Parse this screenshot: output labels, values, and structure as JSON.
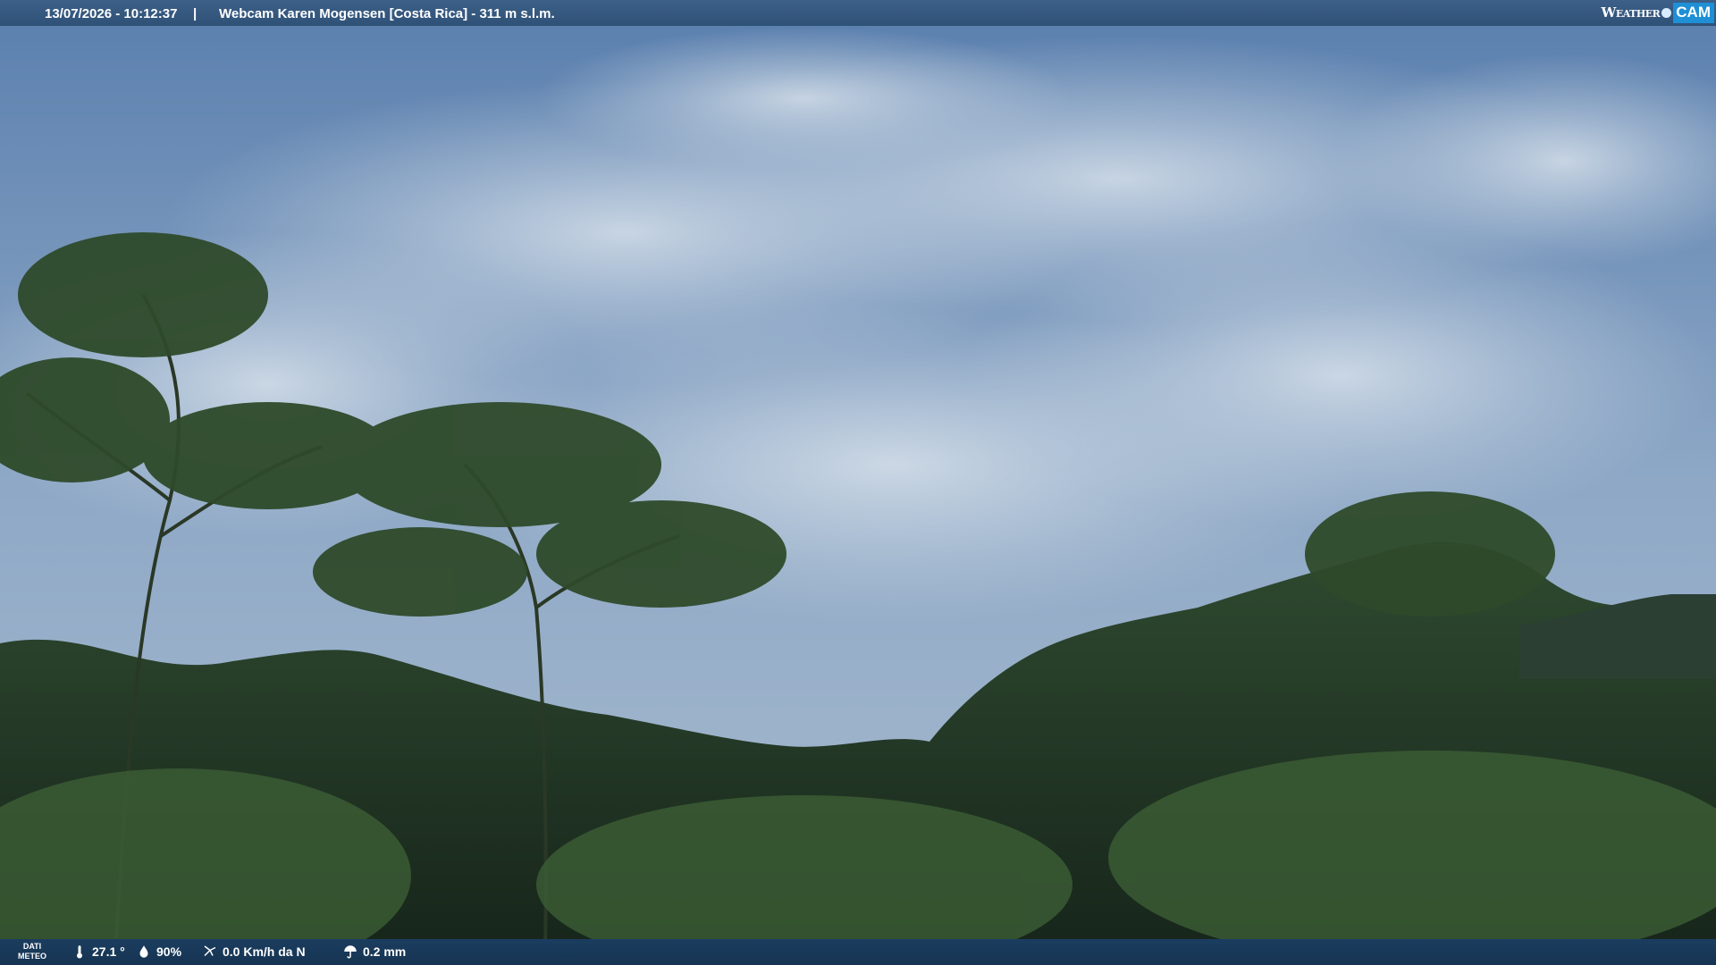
{
  "header": {
    "datetime": "13/07/2026 - 10:12:37",
    "separator": "|",
    "title": "Webcam Karen Mogensen [Costa Rica]  - 311 m s.l.m."
  },
  "logo": {
    "word": "Weather",
    "cam": "CAM"
  },
  "footer": {
    "label_line1": "DATI",
    "label_line2": "METEO",
    "temperature": "27.1 °",
    "humidity": "90%",
    "wind": "0.0 Km/h da N",
    "rain": "0.2 mm"
  },
  "icons": [
    "thermometer-icon",
    "humidity-drop-icon",
    "wind-icon",
    "rain-umbrella-icon"
  ],
  "colors": {
    "topbar": "#2f5177",
    "bottombar": "#163452",
    "cam_badge": "#1f8fd6"
  }
}
